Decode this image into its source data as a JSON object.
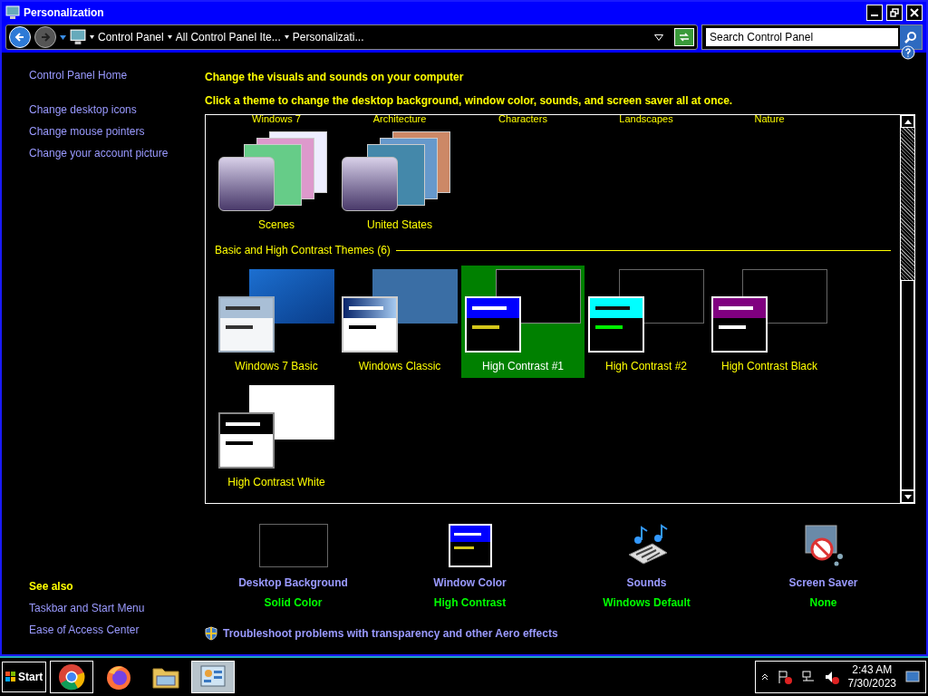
{
  "window": {
    "title": "Personalization"
  },
  "address_bar": {
    "crumbs": [
      "Control Panel",
      "All Control Panel Ite...",
      "Personalizati..."
    ]
  },
  "search": {
    "placeholder": "Search Control Panel"
  },
  "sidebar": {
    "home": "Control Panel Home",
    "links": [
      "Change desktop icons",
      "Change mouse pointers",
      "Change your account picture"
    ],
    "see_also_title": "See also",
    "see_also": [
      "Taskbar and Start Menu",
      "Ease of Access Center"
    ]
  },
  "heading": "Change the visuals and sounds on your computer",
  "subheading": "Click a theme to change the desktop background, window color, sounds, and screen saver all at once.",
  "cut_row": [
    "Windows 7",
    "Architecture",
    "Characters",
    "Landscapes",
    "Nature"
  ],
  "my_themes": [
    {
      "name": "Scenes",
      "kind": "scenes",
      "selected": false
    },
    {
      "name": "United States",
      "kind": "usa",
      "selected": false
    }
  ],
  "basic_section": {
    "title": "Basic and High Contrast Themes (6)",
    "themes": [
      {
        "name": "Windows 7 Basic",
        "kind": "win7",
        "selected": false
      },
      {
        "name": "Windows Classic",
        "kind": "classic",
        "selected": false
      },
      {
        "name": "High Contrast #1",
        "kind": "hc1",
        "selected": true
      },
      {
        "name": "High Contrast #2",
        "kind": "hc2",
        "selected": false
      },
      {
        "name": "High Contrast Black",
        "kind": "hcblack",
        "selected": false
      },
      {
        "name": "High Contrast White",
        "kind": "hcwhite",
        "selected": false
      }
    ]
  },
  "settings": [
    {
      "label": "Desktop Background",
      "value": "Solid Color",
      "kind": "background"
    },
    {
      "label": "Window Color",
      "value": "High Contrast",
      "kind": "color"
    },
    {
      "label": "Sounds",
      "value": "Windows Default",
      "kind": "sounds"
    },
    {
      "label": "Screen Saver",
      "value": "None",
      "kind": "saver"
    }
  ],
  "troubleshoot_link": "Troubleshoot problems with transparency and other Aero effects",
  "taskbar": {
    "start": "Start",
    "apps": [
      {
        "kind": "chrome",
        "selected": false
      },
      {
        "kind": "firefox",
        "selected": false
      },
      {
        "kind": "explorer",
        "selected": false
      },
      {
        "kind": "control",
        "selected": true
      }
    ],
    "time": "2:43 AM",
    "date": "7/30/2023"
  }
}
